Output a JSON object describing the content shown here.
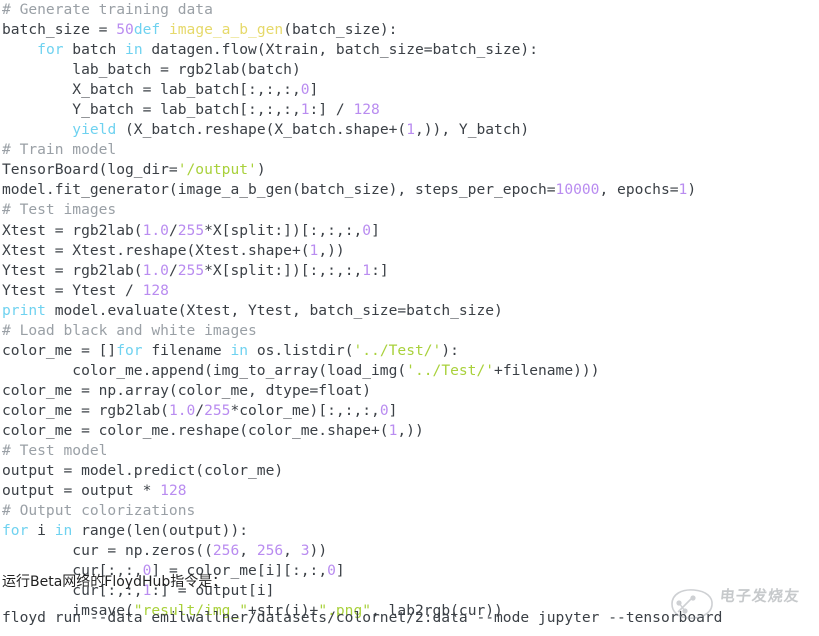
{
  "document": {
    "type": "code-listing-article",
    "background_color": "#ffffff",
    "default_text_color": "#3b4046"
  },
  "theme": {
    "comment_color": "#9aa0a6",
    "keyword_color": "#6fd2f0",
    "function_color": "#e6d96a",
    "number_color": "#b98cf0",
    "string_color": "#a9d13c",
    "plain_color": "#3b4046"
  },
  "code": {
    "language": "python",
    "lines": [
      [
        {
          "t": "# Generate training data",
          "c": "com"
        }
      ],
      [
        {
          "t": "batch_size = ",
          "c": "plain"
        },
        {
          "t": "50",
          "c": "num"
        },
        {
          "t": "def ",
          "c": "kw"
        },
        {
          "t": "image_a_b_gen",
          "c": "fn"
        },
        {
          "t": "(batch_size):",
          "c": "plain"
        }
      ],
      [
        {
          "t": "    ",
          "c": "plain"
        },
        {
          "t": "for",
          "c": "kw"
        },
        {
          "t": " batch ",
          "c": "plain"
        },
        {
          "t": "in",
          "c": "kw"
        },
        {
          "t": " datagen.flow(Xtrain, batch_size=batch_size):",
          "c": "plain"
        }
      ],
      [
        {
          "t": "        lab_batch = rgb2lab(batch)",
          "c": "plain"
        }
      ],
      [
        {
          "t": "        X_batch = lab_batch[:,:,:,",
          "c": "plain"
        },
        {
          "t": "0",
          "c": "num"
        },
        {
          "t": "]",
          "c": "plain"
        }
      ],
      [
        {
          "t": "        Y_batch = lab_batch[:,:,:,",
          "c": "plain"
        },
        {
          "t": "1",
          "c": "num"
        },
        {
          "t": ":] / ",
          "c": "plain"
        },
        {
          "t": "128",
          "c": "num"
        }
      ],
      [
        {
          "t": "        ",
          "c": "plain"
        },
        {
          "t": "yield",
          "c": "kw"
        },
        {
          "t": " (X_batch.reshape(X_batch.shape+(",
          "c": "plain"
        },
        {
          "t": "1",
          "c": "num"
        },
        {
          "t": ",)), Y_batch)",
          "c": "plain"
        }
      ],
      [
        {
          "t": "# Train model",
          "c": "com"
        }
      ],
      [
        {
          "t": "TensorBoard(log_dir=",
          "c": "plain"
        },
        {
          "t": "'/output'",
          "c": "str"
        },
        {
          "t": ")",
          "c": "plain"
        }
      ],
      [
        {
          "t": "model.fit_generator(image_a_b_gen(batch_size), steps_per_epoch=",
          "c": "plain"
        },
        {
          "t": "10000",
          "c": "num"
        },
        {
          "t": ", epochs=",
          "c": "plain"
        },
        {
          "t": "1",
          "c": "num"
        },
        {
          "t": ")",
          "c": "plain"
        }
      ],
      [
        {
          "t": "# Test images",
          "c": "com"
        }
      ],
      [
        {
          "t": "Xtest = rgb2lab(",
          "c": "plain"
        },
        {
          "t": "1.0",
          "c": "num"
        },
        {
          "t": "/",
          "c": "plain"
        },
        {
          "t": "255",
          "c": "num"
        },
        {
          "t": "*X[split:])[:,:,:,",
          "c": "plain"
        },
        {
          "t": "0",
          "c": "num"
        },
        {
          "t": "]",
          "c": "plain"
        }
      ],
      [
        {
          "t": "Xtest = Xtest.reshape(Xtest.shape+(",
          "c": "plain"
        },
        {
          "t": "1",
          "c": "num"
        },
        {
          "t": ",))",
          "c": "plain"
        }
      ],
      [
        {
          "t": "Ytest = rgb2lab(",
          "c": "plain"
        },
        {
          "t": "1.0",
          "c": "num"
        },
        {
          "t": "/",
          "c": "plain"
        },
        {
          "t": "255",
          "c": "num"
        },
        {
          "t": "*X[split:])[:,:,:,",
          "c": "plain"
        },
        {
          "t": "1",
          "c": "num"
        },
        {
          "t": ":]",
          "c": "plain"
        }
      ],
      [
        {
          "t": "Ytest = Ytest / ",
          "c": "plain"
        },
        {
          "t": "128",
          "c": "num"
        }
      ],
      [
        {
          "t": "print",
          "c": "kw"
        },
        {
          "t": " model.evaluate(Xtest, Ytest, batch_size=batch_size)",
          "c": "plain"
        }
      ],
      [
        {
          "t": "# Load black and white images",
          "c": "com"
        }
      ],
      [
        {
          "t": "color_me = []",
          "c": "plain"
        },
        {
          "t": "for",
          "c": "kw"
        },
        {
          "t": " filename ",
          "c": "plain"
        },
        {
          "t": "in",
          "c": "kw"
        },
        {
          "t": " os.listdir(",
          "c": "plain"
        },
        {
          "t": "'../Test/'",
          "c": "str"
        },
        {
          "t": "):",
          "c": "plain"
        }
      ],
      [
        {
          "t": "        color_me.append(img_to_array(load_img(",
          "c": "plain"
        },
        {
          "t": "'../Test/'",
          "c": "str"
        },
        {
          "t": "+filename)))",
          "c": "plain"
        }
      ],
      [
        {
          "t": "color_me = np.array(color_me, dtype=float)",
          "c": "plain"
        }
      ],
      [
        {
          "t": "color_me = rgb2lab(",
          "c": "plain"
        },
        {
          "t": "1.0",
          "c": "num"
        },
        {
          "t": "/",
          "c": "plain"
        },
        {
          "t": "255",
          "c": "num"
        },
        {
          "t": "*color_me)[:,:,:,",
          "c": "plain"
        },
        {
          "t": "0",
          "c": "num"
        },
        {
          "t": "]",
          "c": "plain"
        }
      ],
      [
        {
          "t": "color_me = color_me.reshape(color_me.shape+(",
          "c": "plain"
        },
        {
          "t": "1",
          "c": "num"
        },
        {
          "t": ",))",
          "c": "plain"
        }
      ],
      [
        {
          "t": "# Test model",
          "c": "com"
        }
      ],
      [
        {
          "t": "output = model.predict(color_me)",
          "c": "plain"
        }
      ],
      [
        {
          "t": "output = output * ",
          "c": "plain"
        },
        {
          "t": "128",
          "c": "num"
        }
      ],
      [
        {
          "t": "# Output colorizations",
          "c": "com"
        }
      ],
      [
        {
          "t": "for",
          "c": "kw"
        },
        {
          "t": " i ",
          "c": "plain"
        },
        {
          "t": "in",
          "c": "kw"
        },
        {
          "t": " range(len(output)):",
          "c": "plain"
        }
      ],
      [
        {
          "t": "        cur = np.zeros((",
          "c": "plain"
        },
        {
          "t": "256",
          "c": "num"
        },
        {
          "t": ", ",
          "c": "plain"
        },
        {
          "t": "256",
          "c": "num"
        },
        {
          "t": ", ",
          "c": "plain"
        },
        {
          "t": "3",
          "c": "num"
        },
        {
          "t": "))",
          "c": "plain"
        }
      ],
      [
        {
          "t": "        cur[:,:,",
          "c": "plain"
        },
        {
          "t": "0",
          "c": "num"
        },
        {
          "t": "] = color_me[i][:,:,",
          "c": "plain"
        },
        {
          "t": "0",
          "c": "num"
        },
        {
          "t": "]",
          "c": "plain"
        }
      ],
      [
        {
          "t": "        cur[:,:,",
          "c": "plain"
        },
        {
          "t": "1",
          "c": "num"
        },
        {
          "t": ":] = output[i]",
          "c": "plain"
        }
      ],
      [
        {
          "t": "        imsave(",
          "c": "plain"
        },
        {
          "t": "\"result/img_\"",
          "c": "str"
        },
        {
          "t": "+str(i)+",
          "c": "plain"
        },
        {
          "t": "\".png\"",
          "c": "str"
        },
        {
          "t": ", lab2rgb(cur))",
          "c": "plain"
        }
      ]
    ]
  },
  "prose": {
    "caption": "运行Beta网络的FloydHub指令是：",
    "shell_command": "floyd run --data emilwallner/datasets/colornet/2:data --mode jupyter --tensorboard"
  },
  "watermark": {
    "text": "电子发烧友"
  }
}
